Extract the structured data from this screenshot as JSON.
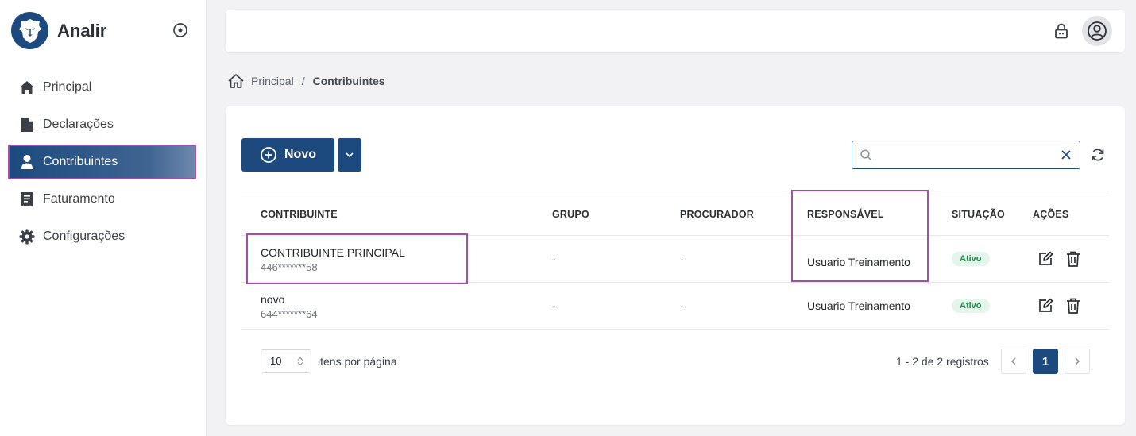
{
  "app": {
    "name": "Analir"
  },
  "sidebar": {
    "items": [
      {
        "label": "Principal",
        "icon": "home-icon"
      },
      {
        "label": "Declarações",
        "icon": "file-icon"
      },
      {
        "label": "Contribuintes",
        "icon": "user-icon",
        "active": true
      },
      {
        "label": "Faturamento",
        "icon": "receipt-icon"
      },
      {
        "label": "Configurações",
        "icon": "gear-icon"
      }
    ]
  },
  "breadcrumb": {
    "home": "Principal",
    "separator": "/",
    "current": "Contribuintes"
  },
  "toolbar": {
    "new_label": "Novo",
    "search_value": "",
    "search_placeholder": ""
  },
  "table": {
    "headers": {
      "contribuinte": "CONTRIBUINTE",
      "grupo": "GRUPO",
      "procurador": "PROCURADOR",
      "responsavel": "RESPONSÁVEL",
      "situacao": "SITUAÇÃO",
      "acoes": "AÇÕES"
    },
    "rows": [
      {
        "name": "CONTRIBUINTE PRINCIPAL",
        "doc": "446*******58",
        "grupo": "-",
        "procurador": "-",
        "responsavel": "Usuario Treinamento",
        "situacao": "Ativo"
      },
      {
        "name": "novo",
        "doc": "644*******64",
        "grupo": "-",
        "procurador": "-",
        "responsavel": "Usuario Treinamento",
        "situacao": "Ativo"
      }
    ]
  },
  "pagination": {
    "page_size": "10",
    "per_page_label": "itens por página",
    "range": "1 - 2 de 2 registros",
    "current_page": "1"
  },
  "colors": {
    "primary": "#1c4a7e",
    "highlight": "#a24fa8",
    "badge_bg": "#e4f5eb",
    "badge_text": "#1f8a4c"
  }
}
